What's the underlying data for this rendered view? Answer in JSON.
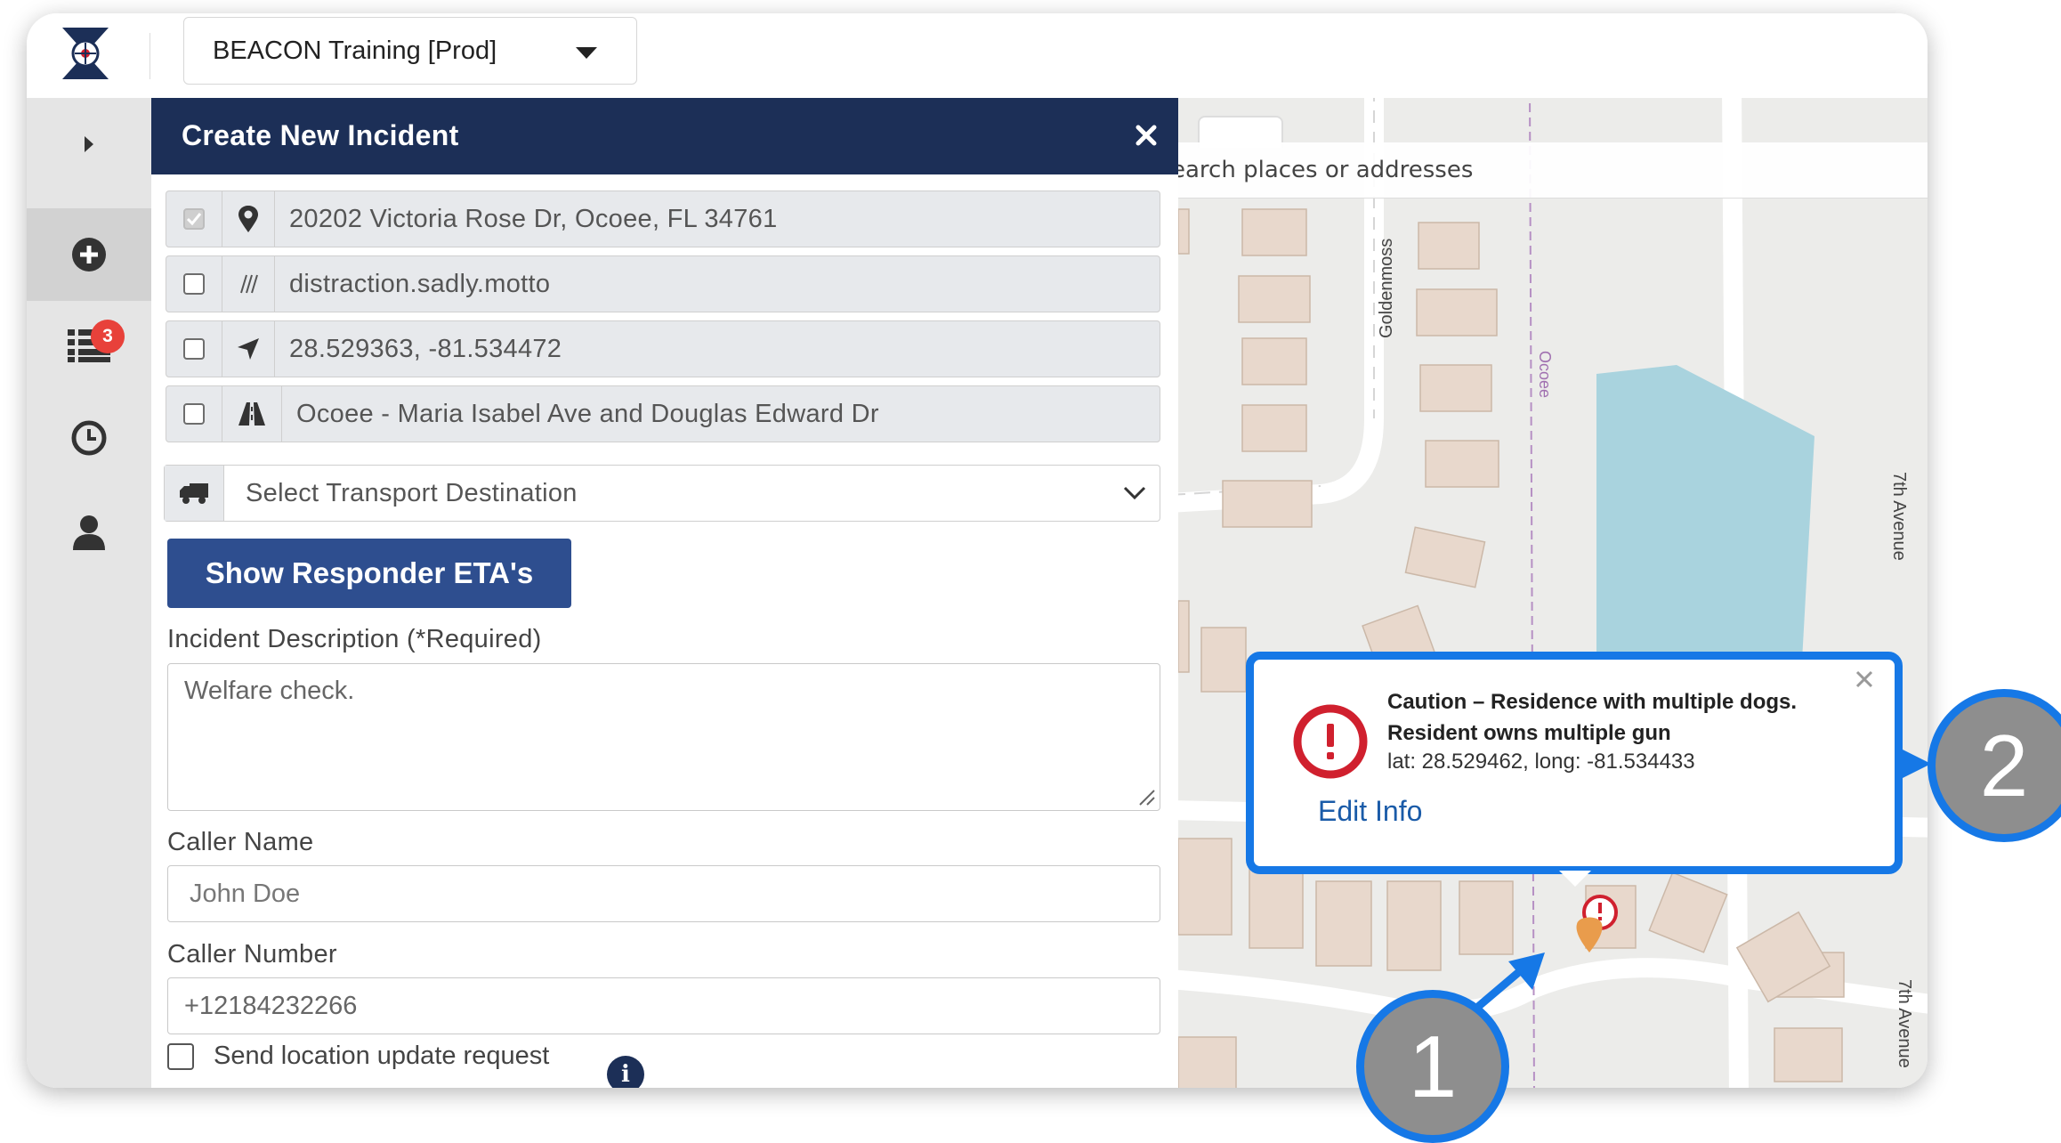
{
  "header": {
    "org_name": "BEACON Training [Prod]"
  },
  "sidebar": {
    "queue_badge": "3"
  },
  "map": {
    "search_placeholder": "earch places or addresses",
    "street_labels": {
      "goldenmoss": "Goldenmoss",
      "ocoee": "Ocoee",
      "seventh_upper": "7th Avenue",
      "seventh_lower": "7th Avenue"
    }
  },
  "panel": {
    "title": "Create New Incident",
    "location_rows": [
      {
        "text": "20202 Victoria Rose Dr, Ocoee, FL 34761",
        "checked": true,
        "icon": "map-pin-icon"
      },
      {
        "text": "distraction.sadly.motto",
        "checked": false,
        "icon": "what3words-icon"
      },
      {
        "text": "28.529363, -81.534472",
        "checked": false,
        "icon": "location-arrow-icon"
      },
      {
        "text": "Ocoee -  Maria Isabel Ave and Douglas Edward Dr",
        "checked": false,
        "icon": "road-icon"
      }
    ],
    "transport_placeholder": "Select Transport Destination",
    "eta_button": "Show Responder ETA's",
    "description_label": "Incident Description (*Required)",
    "description_value": "Welfare check.",
    "caller_name_label": "Caller Name",
    "caller_name_placeholder": "John Doe",
    "caller_number_label": "Caller Number",
    "caller_number_value": "+12184232266",
    "send_location_label": "Send location update request"
  },
  "popup": {
    "title": "Caution – Residence with multiple dogs. Resident owns multiple gun",
    "coords": "lat: 28.529462, long: -81.534433",
    "edit_link": "Edit Info"
  },
  "callouts": {
    "one": "1",
    "two": "2"
  },
  "colors": {
    "panel_header": "#1c2f57",
    "button": "#2e4e8f",
    "callout_border": "#1678e6",
    "badge": "#e8413a",
    "caution": "#d0202e",
    "water": "#a9d3de",
    "building": "#e8d8cc"
  }
}
